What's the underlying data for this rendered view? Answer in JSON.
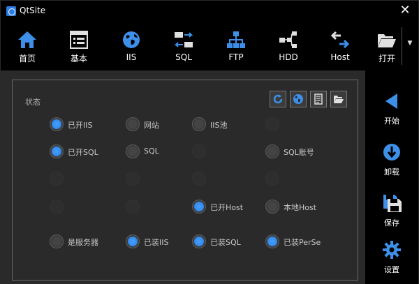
{
  "window": {
    "title": "QtSite",
    "close_glyph": "✕"
  },
  "toolbar": {
    "items": [
      {
        "label": "首页",
        "icon": "home-icon"
      },
      {
        "label": "基本",
        "icon": "list-icon"
      },
      {
        "label": "IIS",
        "icon": "globe-icon"
      },
      {
        "label": "SQL",
        "icon": "switch-icon"
      },
      {
        "label": "FTP",
        "icon": "network-icon"
      },
      {
        "label": "HDD",
        "icon": "nodes-icon"
      },
      {
        "label": "Host",
        "icon": "transfer-icon"
      },
      {
        "label": "打开",
        "icon": "folder-open-icon"
      }
    ],
    "overflow_glyph": "▼"
  },
  "status_group": {
    "label": "状态",
    "tools": [
      "refresh-icon",
      "globe-icon",
      "document-icon",
      "folder-open-icon"
    ],
    "rows": [
      [
        {
          "label": "已开IIS",
          "state": "on"
        },
        {
          "label": "网站",
          "state": "off"
        },
        {
          "label": "IIS池",
          "state": "off"
        },
        {
          "label": "",
          "state": "ghost"
        }
      ],
      [
        {
          "label": "已开SQL",
          "state": "on"
        },
        {
          "label": "SQL",
          "state": "off"
        },
        {
          "label": "",
          "state": "ghost"
        },
        {
          "label": "SQL账号",
          "state": "off"
        }
      ],
      [
        {
          "label": "",
          "state": "ghost"
        },
        {
          "label": "",
          "state": "ghost"
        },
        {
          "label": "",
          "state": "ghost"
        },
        {
          "label": "",
          "state": "ghost"
        }
      ],
      [
        {
          "label": "",
          "state": "ghost"
        },
        {
          "label": "",
          "state": "ghost"
        },
        {
          "label": "已开Host",
          "state": "on"
        },
        {
          "label": "本地Host",
          "state": "off"
        }
      ],
      [
        {
          "label": "是服务器",
          "state": "off"
        },
        {
          "label": "已装IIS",
          "state": "on"
        },
        {
          "label": "已装SQL",
          "state": "on"
        },
        {
          "label": "已装PerSe",
          "state": "on"
        }
      ]
    ]
  },
  "side": {
    "buttons": [
      {
        "label": "开始",
        "icon": "play-icon"
      },
      {
        "label": "卸载",
        "icon": "download-icon"
      },
      {
        "label": "保存",
        "icon": "save-icon"
      },
      {
        "label": "设置",
        "icon": "gear-icon"
      }
    ]
  },
  "colors": {
    "accent": "#2f87ea",
    "panel": "#2a2a2a",
    "background": "#000000"
  }
}
